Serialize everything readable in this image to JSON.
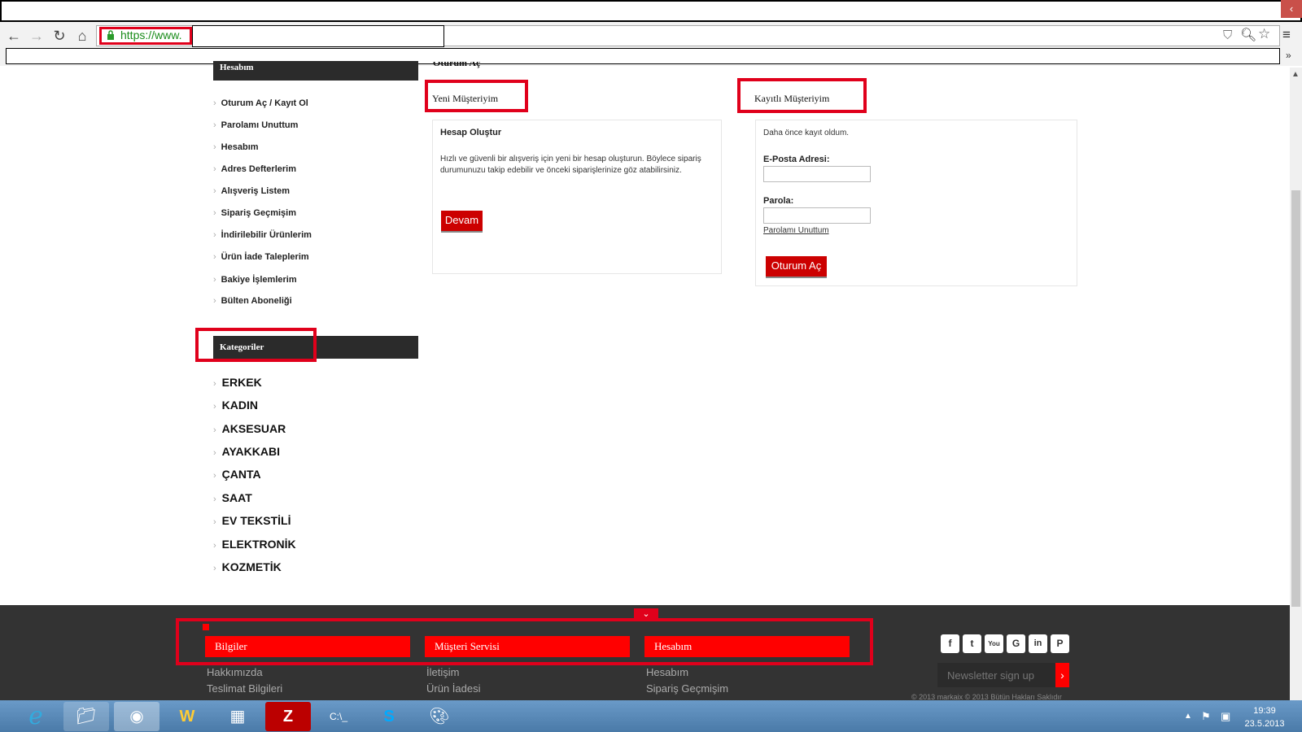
{
  "browser": {
    "url_text": "https://www.",
    "more_label": "»",
    "win_close": "‹"
  },
  "sidebar": {
    "account_header": "Hesabım",
    "account_links": [
      "Oturum Aç / Kayıt Ol",
      "Parolamı Unuttum",
      "Hesabım",
      "Adres Defterlerim",
      "Alışveriş Listem",
      "Sipariş Geçmişim",
      "İndirilebilir Ürünlerim",
      "Ürün İade Taleplerim",
      "Bakiye İşlemlerim",
      "Bülten Aboneliği"
    ],
    "categories_header": "Kategoriler",
    "categories": [
      "ERKEK",
      "KADIN",
      "AKSESUAR",
      "AYAKKABI",
      "ÇANTA",
      "SAAT",
      "EV TEKSTİLİ",
      "ELEKTRONİK",
      "KOZMETİK"
    ]
  },
  "main": {
    "page_heading": "Oturum Aç",
    "new_customer": {
      "title": "Yeni Müşteriyim",
      "subtitle": "Hesap Oluştur",
      "text": "Hızlı ve güvenli bir alışveriş için yeni bir hesap oluşturun. Böylece sipariş durumunuzu takip edebilir ve önceki siparişlerinize göz atabilirsiniz.",
      "button": "Devam"
    },
    "returning_customer": {
      "title": "Kayıtlı Müşteriyim",
      "intro": "Daha önce kayıt oldum.",
      "email_label": "E-Posta Adresi:",
      "email_value": "",
      "password_label": "Parola:",
      "password_value": "",
      "forgot_link": "Parolamı Unuttum",
      "button": "Oturum Aç"
    }
  },
  "footer": {
    "columns": [
      {
        "title": "Bilgiler",
        "links": [
          "Hakkımızda",
          "Teslimat Bilgileri"
        ]
      },
      {
        "title": "Müşteri Servisi",
        "links": [
          "İletişim",
          "Ürün İadesi"
        ]
      },
      {
        "title": "Hesabım",
        "links": [
          "Hesabım",
          "Sipariş Geçmişim"
        ]
      }
    ],
    "social_icons": [
      "facebook-icon",
      "twitter-icon",
      "youtube-icon",
      "google-icon",
      "linkedin-icon",
      "pinterest-icon"
    ],
    "newsletter_placeholder": "Newsletter sign up",
    "copyright": "© 2013 markaix © 2013 Bütün Hakları Saklıdır"
  },
  "taskbar": {
    "time": "19:39",
    "date": "23.5.2013"
  },
  "colors": {
    "accent_red": "#e0001b",
    "button_red": "#cc0000",
    "dark_header": "#2b2b2b",
    "footer_bg": "#333333"
  }
}
